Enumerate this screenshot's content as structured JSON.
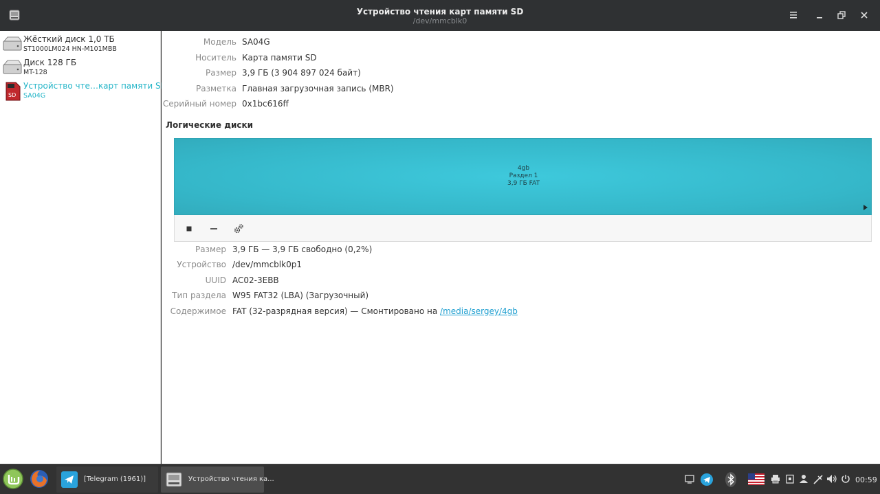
{
  "window": {
    "title": "Устройство чтения карт памяти SD",
    "subtitle": "/dev/mmcblk0"
  },
  "sidebar": {
    "devices": [
      {
        "name": "Жёсткий диск 1,0 ТБ",
        "model": "ST1000LM024 HN-M101MBB",
        "icon": "hdd-icon"
      },
      {
        "name": "Диск 128 ГБ",
        "model": "MT-128",
        "icon": "hdd-icon"
      },
      {
        "name": "Устройство чте…карт памяти SD",
        "model": "SA04G",
        "icon": "sd-card-icon",
        "selected": true
      }
    ]
  },
  "drive": {
    "rows": [
      {
        "label": "Модель",
        "value": "SA04G"
      },
      {
        "label": "Носитель",
        "value": "Карта памяти SD"
      },
      {
        "label": "Размер",
        "value": "3,9 ГБ (3 904 897 024 байт)"
      },
      {
        "label": "Разметка",
        "value": "Главная загрузочная запись (MBR)"
      },
      {
        "label": "Серийный номер",
        "value": "0x1bc616ff"
      }
    ]
  },
  "volumes": {
    "title": "Логические диски",
    "partition": {
      "name": "4gb",
      "label": "Раздел 1",
      "info": "3,9 ГБ FAT"
    }
  },
  "partition_details": {
    "rows": [
      {
        "label": "Размер",
        "value": "3,9 ГБ — 3,9 ГБ свободно (0,2%)"
      },
      {
        "label": "Устройство",
        "value": "/dev/mmcblk0p1"
      },
      {
        "label": "UUID",
        "value": "AC02-3EBB"
      },
      {
        "label": "Тип раздела",
        "value": "W95 FAT32 (LBA) (Загрузочный)"
      }
    ],
    "contents": {
      "label": "Содержимое",
      "text": "FAT (32-разрядная версия) — Смонтировано на ",
      "link": "/media/sergey/4gb"
    }
  },
  "taskbar": {
    "tasks": [
      {
        "label": "[Telegram (1961)]"
      },
      {
        "label": "Устройство чтения ка..."
      }
    ],
    "clock": "00:59"
  },
  "colors": {
    "accent": "#24b5c8",
    "volume": "#3ec9dc",
    "link": "#1f9fd0"
  }
}
